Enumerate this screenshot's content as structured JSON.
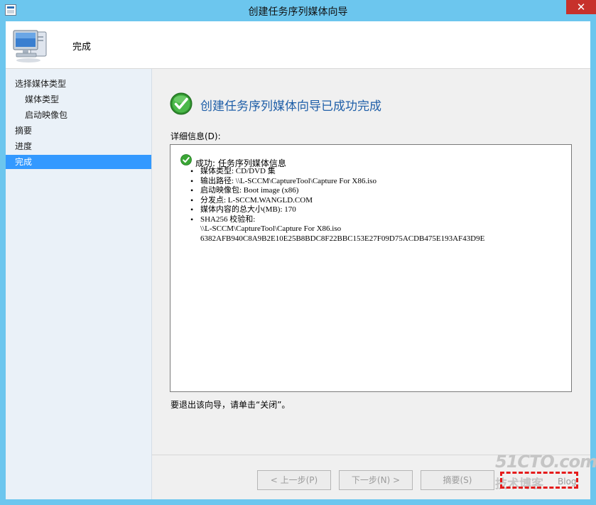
{
  "window": {
    "title": "创建任务序列媒体向导",
    "close_label": "✕"
  },
  "header": {
    "title": "完成",
    "icon": "computer-icon"
  },
  "sidebar": {
    "items": [
      {
        "label": "选择媒体类型",
        "level": 0,
        "active": false
      },
      {
        "label": "媒体类型",
        "level": 1,
        "active": false
      },
      {
        "label": "启动映像包",
        "level": 1,
        "active": false
      },
      {
        "label": "摘要",
        "level": 0,
        "active": false
      },
      {
        "label": "进度",
        "level": 0,
        "active": false
      },
      {
        "label": "完成",
        "level": 0,
        "active": true
      }
    ]
  },
  "main": {
    "heading": "创建任务序列媒体向导已成功完成",
    "details_label": "详细信息(D):",
    "details": {
      "status": "成功: 任务序列媒体信息",
      "lines": [
        "媒体类型: CD/DVD 集",
        "输出路径: \\\\L-SCCM\\CaptureTool\\Capture For X86.iso",
        "启动映像包: Boot image (x86)",
        "分发点: L-SCCM.WANGLD.COM",
        "媒体内容的总大小(MB):  170",
        "SHA256 校验和:"
      ],
      "continuation": [
        "\\\\L-SCCM\\CaptureTool\\Capture For X86.iso",
        "6382AFB940C8A9B2E10E25B8BDC8F22BBC153E27F09D75ACDB475E193AF43D9E"
      ]
    },
    "exit_note": "要退出该向导，请单击“关闭”。"
  },
  "buttons": {
    "prev": "< 上一步(P)",
    "next": "下一步(N) >",
    "summary": "摘要(S)"
  },
  "watermark": {
    "main": "51CTO.com",
    "sub": "技术博客",
    "blog": "Blog"
  },
  "colors": {
    "titlebar": "#6cc6ee",
    "close": "#c7312b",
    "active_nav": "#3399ff",
    "heading": "#1f5fa8",
    "success_green": "#3aa635"
  }
}
